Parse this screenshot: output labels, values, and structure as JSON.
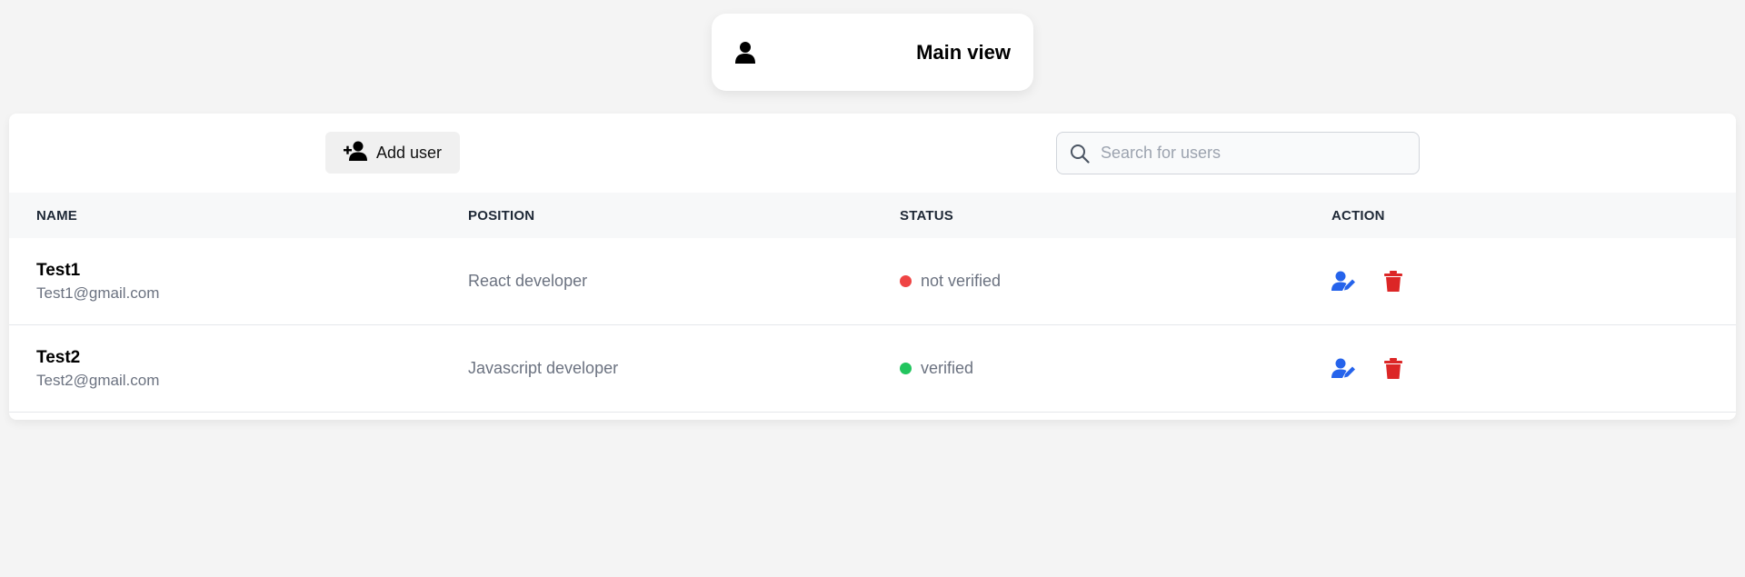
{
  "header": {
    "title": "Main view",
    "icon": "user-icon"
  },
  "toolbar": {
    "add_label": "Add user",
    "add_icon": "user-plus-icon",
    "search": {
      "placeholder": "Search for users",
      "value": "",
      "icon": "search-icon"
    }
  },
  "table": {
    "columns": {
      "name": "Name",
      "position": "Position",
      "status": "Status",
      "action": "Action"
    },
    "rows": [
      {
        "name": "Test1",
        "email": "Test1@gmail.com",
        "position": "React developer",
        "status": "not verified",
        "status_color": "#ef4444"
      },
      {
        "name": "Test2",
        "email": "Test2@gmail.com",
        "position": "Javascript developer",
        "status": "verified",
        "status_color": "#22c55e"
      }
    ]
  },
  "colors": {
    "edit": "#2563eb",
    "delete": "#dc2626"
  }
}
